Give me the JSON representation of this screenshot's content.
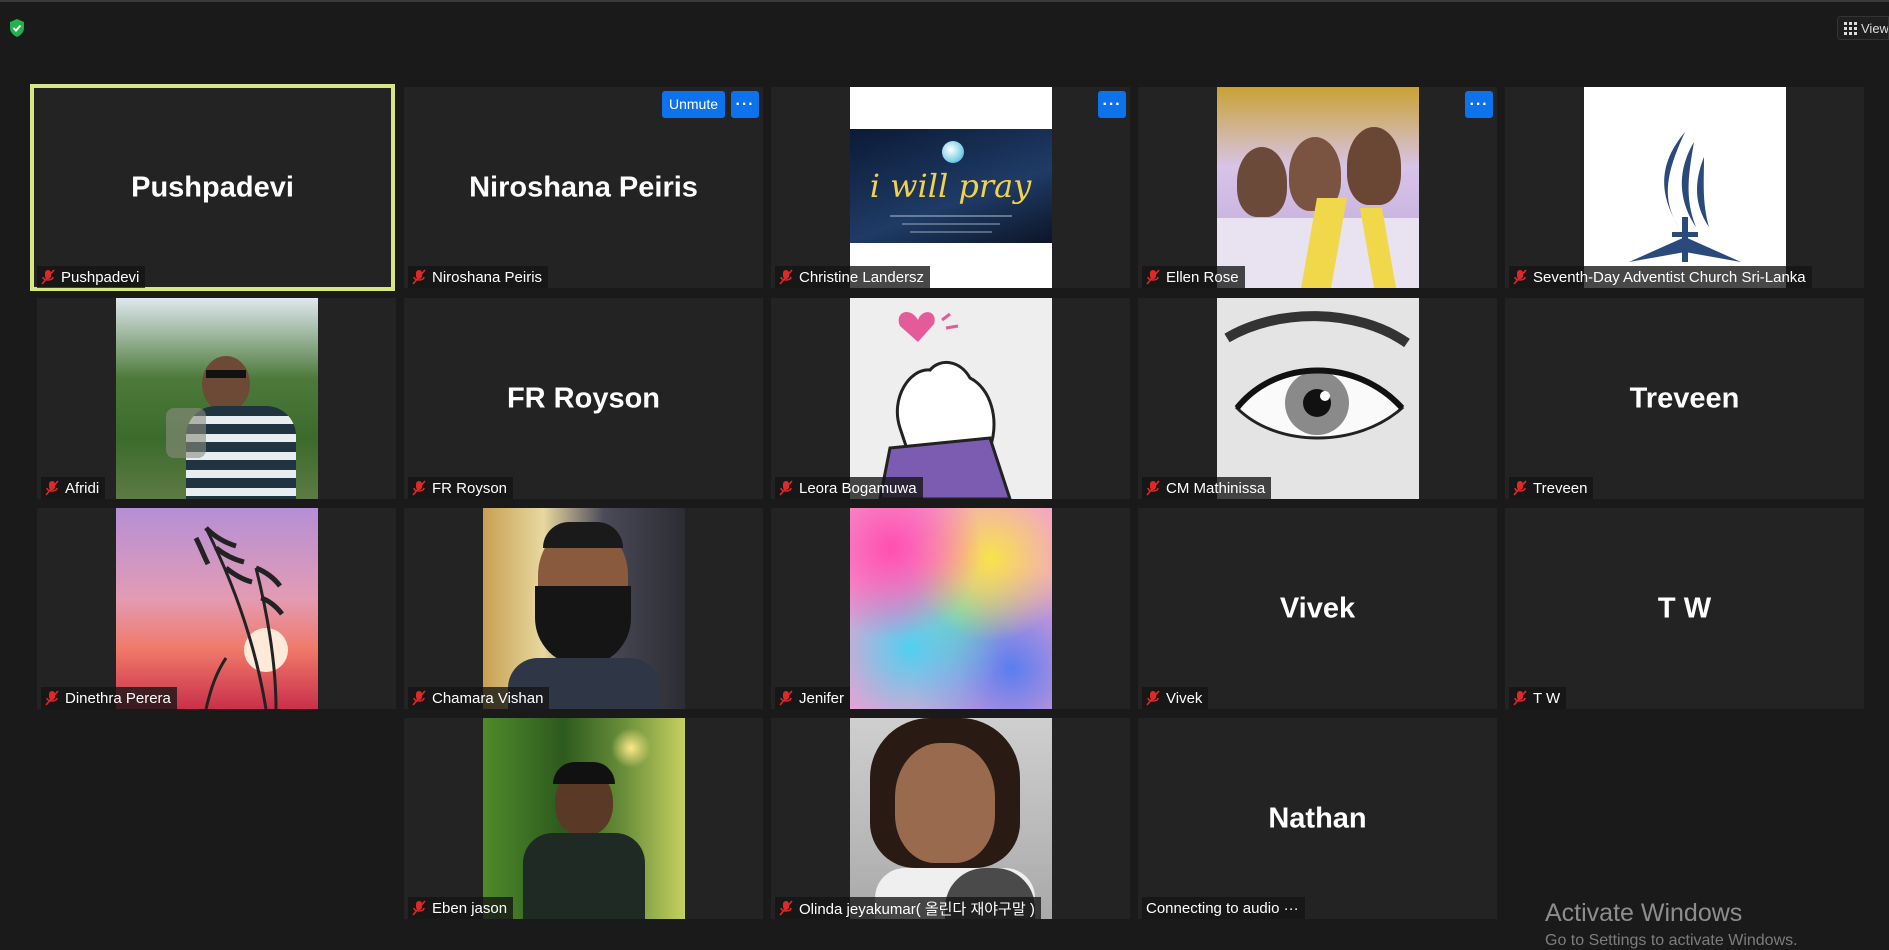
{
  "toolbar": {
    "view_label": "View"
  },
  "tiles": [
    {
      "id": "pushpadevi",
      "big_name": "Pushpadevi",
      "label": "Pushpadevi"
    },
    {
      "id": "niroshana",
      "big_name": "Niroshana Peiris",
      "label": "Niroshana Peiris",
      "unmute_label": "Unmute",
      "more_label": "···"
    },
    {
      "id": "christine",
      "label": "Christine Landersz",
      "photo_text": "i will pray",
      "more_label": "···"
    },
    {
      "id": "ellen",
      "label": "Ellen Rose",
      "more_label": "···"
    },
    {
      "id": "sda",
      "label": "Seventh-Day Adventist Church Sri-Lanka"
    },
    {
      "id": "afridi",
      "label": "Afridi"
    },
    {
      "id": "frroyson",
      "big_name": "FR Royson",
      "label": "FR Royson"
    },
    {
      "id": "leora",
      "label": "Leora Bogamuwa"
    },
    {
      "id": "cm",
      "label": "CM Mathinissa"
    },
    {
      "id": "treveen",
      "big_name": "Treveen",
      "label": "Treveen"
    },
    {
      "id": "dinethra",
      "label": "Dinethra Perera"
    },
    {
      "id": "chamara",
      "label": "Chamara Vishan"
    },
    {
      "id": "jenifer",
      "label": "Jenifer"
    },
    {
      "id": "vivek",
      "big_name": "Vivek",
      "label": "Vivek"
    },
    {
      "id": "tw",
      "big_name": "T W",
      "label": "T W"
    },
    {
      "id": "eben",
      "label": "Eben jason"
    },
    {
      "id": "olinda",
      "label": "Olinda jeyakumar( 올린다 재야구말 )"
    },
    {
      "id": "nathan",
      "big_name": "Nathan",
      "label": "Connecting to audio ···"
    }
  ],
  "watermark": {
    "title": "Activate Windows",
    "subtitle": "Go to Settings to activate Windows."
  },
  "colors": {
    "active_speaker": "#d7e784",
    "accent": "#0e72ed",
    "muted_mic": "#e02828"
  }
}
